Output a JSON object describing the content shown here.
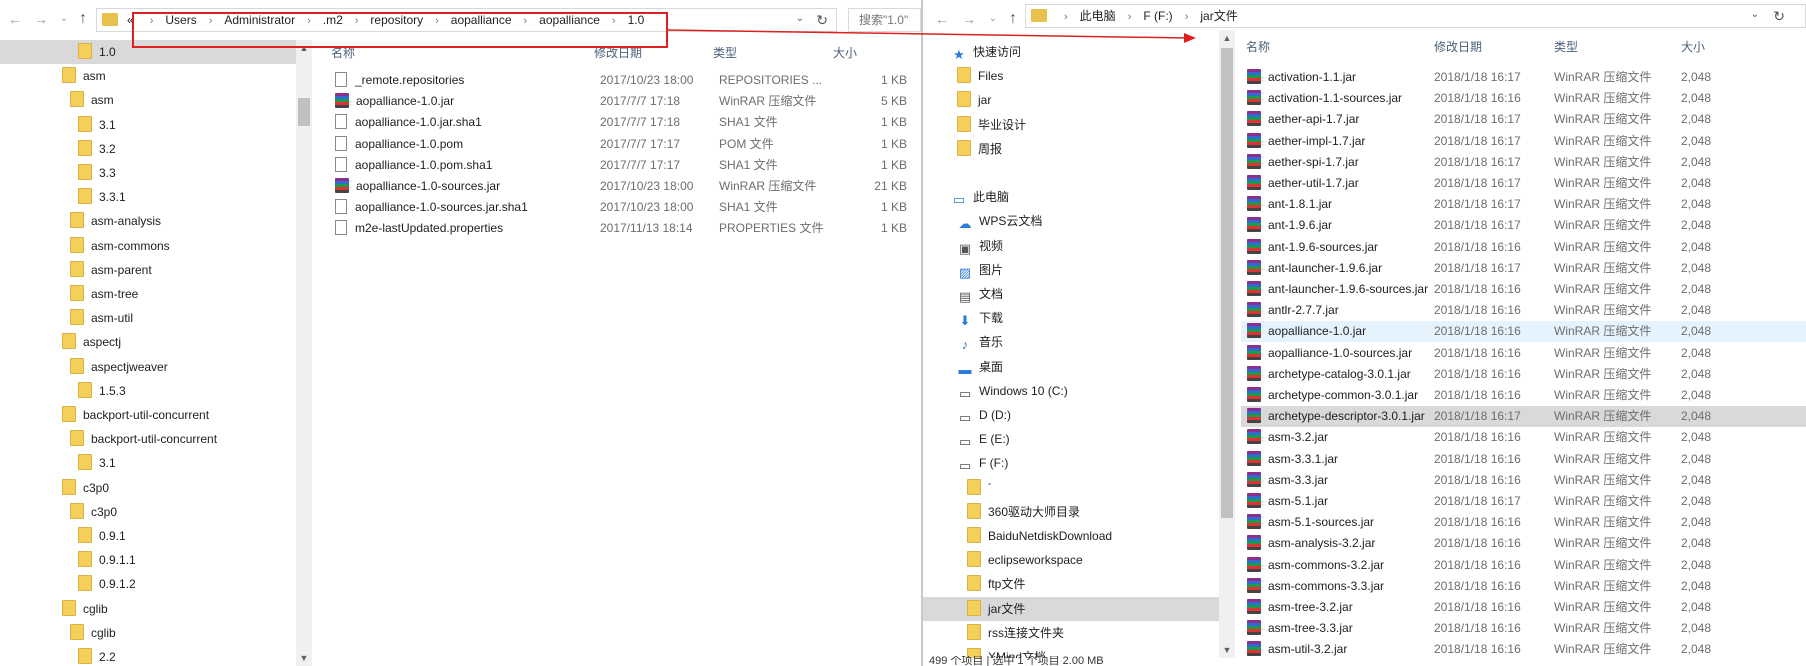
{
  "left": {
    "address": {
      "overflow": "«",
      "crumbs": [
        "Users",
        "Administrator",
        ".m2",
        "repository",
        "aopalliance",
        "aopalliance",
        "1.0"
      ]
    },
    "search_placeholder": "搜索\"1.0\"",
    "tree": [
      {
        "label": "1.0",
        "level": 2,
        "selected": true
      },
      {
        "label": "asm",
        "level": 0
      },
      {
        "label": "asm",
        "level": 1
      },
      {
        "label": "3.1",
        "level": 2
      },
      {
        "label": "3.2",
        "level": 2
      },
      {
        "label": "3.3",
        "level": 2
      },
      {
        "label": "3.3.1",
        "level": 2
      },
      {
        "label": "asm-analysis",
        "level": 1
      },
      {
        "label": "asm-commons",
        "level": 1
      },
      {
        "label": "asm-parent",
        "level": 1
      },
      {
        "label": "asm-tree",
        "level": 1
      },
      {
        "label": "asm-util",
        "level": 1
      },
      {
        "label": "aspectj",
        "level": 0
      },
      {
        "label": "aspectjweaver",
        "level": 1
      },
      {
        "label": "1.5.3",
        "level": 2
      },
      {
        "label": "backport-util-concurrent",
        "level": 0
      },
      {
        "label": "backport-util-concurrent",
        "level": 1
      },
      {
        "label": "3.1",
        "level": 2
      },
      {
        "label": "c3p0",
        "level": 0
      },
      {
        "label": "c3p0",
        "level": 1
      },
      {
        "label": "0.9.1",
        "level": 2
      },
      {
        "label": "0.9.1.1",
        "level": 2
      },
      {
        "label": "0.9.1.2",
        "level": 2
      },
      {
        "label": "cglib",
        "level": 0
      },
      {
        "label": "cglib",
        "level": 1
      },
      {
        "label": "2.2",
        "level": 2
      }
    ],
    "columns": {
      "name": "名称",
      "date": "修改日期",
      "type": "类型",
      "size": "大小"
    },
    "files": [
      {
        "name": "_remote.repositories",
        "date": "2017/10/23 18:00",
        "type": "REPOSITORIES ...",
        "size": "1 KB",
        "icon": "doc"
      },
      {
        "name": "aopalliance-1.0.jar",
        "date": "2017/7/7 17:18",
        "type": "WinRAR 压缩文件",
        "size": "5 KB",
        "icon": "rar"
      },
      {
        "name": "aopalliance-1.0.jar.sha1",
        "date": "2017/7/7 17:18",
        "type": "SHA1 文件",
        "size": "1 KB",
        "icon": "doc"
      },
      {
        "name": "aopalliance-1.0.pom",
        "date": "2017/7/7 17:17",
        "type": "POM 文件",
        "size": "1 KB",
        "icon": "doc"
      },
      {
        "name": "aopalliance-1.0.pom.sha1",
        "date": "2017/7/7 17:17",
        "type": "SHA1 文件",
        "size": "1 KB",
        "icon": "doc"
      },
      {
        "name": "aopalliance-1.0-sources.jar",
        "date": "2017/10/23 18:00",
        "type": "WinRAR 压缩文件",
        "size": "21 KB",
        "icon": "rar"
      },
      {
        "name": "aopalliance-1.0-sources.jar.sha1",
        "date": "2017/10/23 18:00",
        "type": "SHA1 文件",
        "size": "1 KB",
        "icon": "doc"
      },
      {
        "name": "m2e-lastUpdated.properties",
        "date": "2017/11/13 18:14",
        "type": "PROPERTIES 文件",
        "size": "1 KB",
        "icon": "doc"
      }
    ]
  },
  "right": {
    "address": {
      "crumbs": [
        "此电脑",
        "F (F:)",
        "jar文件"
      ]
    },
    "nav": [
      {
        "label": "快速访问",
        "level": 0,
        "icon": "star"
      },
      {
        "label": "Files",
        "level": 1,
        "icon": "folder"
      },
      {
        "label": "jar",
        "level": 1,
        "icon": "folder"
      },
      {
        "label": "毕业设计",
        "level": 1,
        "icon": "folder"
      },
      {
        "label": "周报",
        "level": 1,
        "icon": "folder"
      },
      {
        "label": "",
        "level": 0,
        "icon": "gap"
      },
      {
        "label": "此电脑",
        "level": 0,
        "icon": "pc"
      },
      {
        "label": "WPS云文档",
        "level": 1,
        "icon": "cloud"
      },
      {
        "label": "视频",
        "level": 1,
        "icon": "video"
      },
      {
        "label": "图片",
        "level": 1,
        "icon": "picture"
      },
      {
        "label": "文档",
        "level": 1,
        "icon": "document"
      },
      {
        "label": "下载",
        "level": 1,
        "icon": "download"
      },
      {
        "label": "音乐",
        "level": 1,
        "icon": "music"
      },
      {
        "label": "桌面",
        "level": 1,
        "icon": "desktop"
      },
      {
        "label": "Windows 10 (C:)",
        "level": 1,
        "icon": "drive"
      },
      {
        "label": "D (D:)",
        "level": 1,
        "icon": "drive"
      },
      {
        "label": "E (E:)",
        "level": 1,
        "icon": "drive"
      },
      {
        "label": "F (F:)",
        "level": 1,
        "icon": "drive"
      },
      {
        "label": "´",
        "level": 2,
        "icon": "folder"
      },
      {
        "label": "360驱动大师目录",
        "level": 2,
        "icon": "folder"
      },
      {
        "label": "BaiduNetdiskDownload",
        "level": 2,
        "icon": "folder"
      },
      {
        "label": "eclipseworkspace",
        "level": 2,
        "icon": "folder"
      },
      {
        "label": "ftp文件",
        "level": 2,
        "icon": "folder"
      },
      {
        "label": "jar文件",
        "level": 2,
        "icon": "folder",
        "selected": true
      },
      {
        "label": "rss连接文件夹",
        "level": 2,
        "icon": "folder"
      },
      {
        "label": "XMind文档",
        "level": 2,
        "icon": "folder"
      }
    ],
    "columns": {
      "name": "名称",
      "date": "修改日期",
      "type": "类型",
      "size": "大小"
    },
    "files": [
      {
        "name": "activation-1.1.jar",
        "date": "2018/1/18 16:17",
        "type": "WinRAR 压缩文件",
        "size": "2,048"
      },
      {
        "name": "activation-1.1-sources.jar",
        "date": "2018/1/18 16:16",
        "type": "WinRAR 压缩文件",
        "size": "2,048"
      },
      {
        "name": "aether-api-1.7.jar",
        "date": "2018/1/18 16:17",
        "type": "WinRAR 压缩文件",
        "size": "2,048"
      },
      {
        "name": "aether-impl-1.7.jar",
        "date": "2018/1/18 16:17",
        "type": "WinRAR 压缩文件",
        "size": "2,048"
      },
      {
        "name": "aether-spi-1.7.jar",
        "date": "2018/1/18 16:17",
        "type": "WinRAR 压缩文件",
        "size": "2,048"
      },
      {
        "name": "aether-util-1.7.jar",
        "date": "2018/1/18 16:17",
        "type": "WinRAR 压缩文件",
        "size": "2,048"
      },
      {
        "name": "ant-1.8.1.jar",
        "date": "2018/1/18 16:17",
        "type": "WinRAR 压缩文件",
        "size": "2,048"
      },
      {
        "name": "ant-1.9.6.jar",
        "date": "2018/1/18 16:17",
        "type": "WinRAR 压缩文件",
        "size": "2,048"
      },
      {
        "name": "ant-1.9.6-sources.jar",
        "date": "2018/1/18 16:16",
        "type": "WinRAR 压缩文件",
        "size": "2,048"
      },
      {
        "name": "ant-launcher-1.9.6.jar",
        "date": "2018/1/18 16:17",
        "type": "WinRAR 压缩文件",
        "size": "2,048"
      },
      {
        "name": "ant-launcher-1.9.6-sources.jar",
        "date": "2018/1/18 16:16",
        "type": "WinRAR 压缩文件",
        "size": "2,048"
      },
      {
        "name": "antlr-2.7.7.jar",
        "date": "2018/1/18 16:16",
        "type": "WinRAR 压缩文件",
        "size": "2,048"
      },
      {
        "name": "aopalliance-1.0.jar",
        "date": "2018/1/18 16:16",
        "type": "WinRAR 压缩文件",
        "size": "2,048",
        "hover": true
      },
      {
        "name": "aopalliance-1.0-sources.jar",
        "date": "2018/1/18 16:16",
        "type": "WinRAR 压缩文件",
        "size": "2,048"
      },
      {
        "name": "archetype-catalog-3.0.1.jar",
        "date": "2018/1/18 16:16",
        "type": "WinRAR 压缩文件",
        "size": "2,048"
      },
      {
        "name": "archetype-common-3.0.1.jar",
        "date": "2018/1/18 16:16",
        "type": "WinRAR 压缩文件",
        "size": "2,048"
      },
      {
        "name": "archetype-descriptor-3.0.1.jar",
        "date": "2018/1/18 16:17",
        "type": "WinRAR 压缩文件",
        "size": "2,048",
        "selected": true
      },
      {
        "name": "asm-3.2.jar",
        "date": "2018/1/18 16:16",
        "type": "WinRAR 压缩文件",
        "size": "2,048"
      },
      {
        "name": "asm-3.3.1.jar",
        "date": "2018/1/18 16:16",
        "type": "WinRAR 压缩文件",
        "size": "2,048"
      },
      {
        "name": "asm-3.3.jar",
        "date": "2018/1/18 16:16",
        "type": "WinRAR 压缩文件",
        "size": "2,048"
      },
      {
        "name": "asm-5.1.jar",
        "date": "2018/1/18 16:17",
        "type": "WinRAR 压缩文件",
        "size": "2,048"
      },
      {
        "name": "asm-5.1-sources.jar",
        "date": "2018/1/18 16:16",
        "type": "WinRAR 压缩文件",
        "size": "2,048"
      },
      {
        "name": "asm-analysis-3.2.jar",
        "date": "2018/1/18 16:16",
        "type": "WinRAR 压缩文件",
        "size": "2,048"
      },
      {
        "name": "asm-commons-3.2.jar",
        "date": "2018/1/18 16:16",
        "type": "WinRAR 压缩文件",
        "size": "2,048"
      },
      {
        "name": "asm-commons-3.3.jar",
        "date": "2018/1/18 16:16",
        "type": "WinRAR 压缩文件",
        "size": "2,048"
      },
      {
        "name": "asm-tree-3.2.jar",
        "date": "2018/1/18 16:16",
        "type": "WinRAR 压缩文件",
        "size": "2,048"
      },
      {
        "name": "asm-tree-3.3.jar",
        "date": "2018/1/18 16:16",
        "type": "WinRAR 压缩文件",
        "size": "2,048"
      },
      {
        "name": "asm-util-3.2.jar",
        "date": "2018/1/18 16:16",
        "type": "WinRAR 压缩文件",
        "size": "2,048"
      }
    ],
    "status": "499 个项目  |  选中 1 个项目 2.00 MB"
  },
  "colors": {
    "highlight": "#e02020",
    "selection": "#d9d9d9",
    "hover": "#e5f3ff"
  }
}
